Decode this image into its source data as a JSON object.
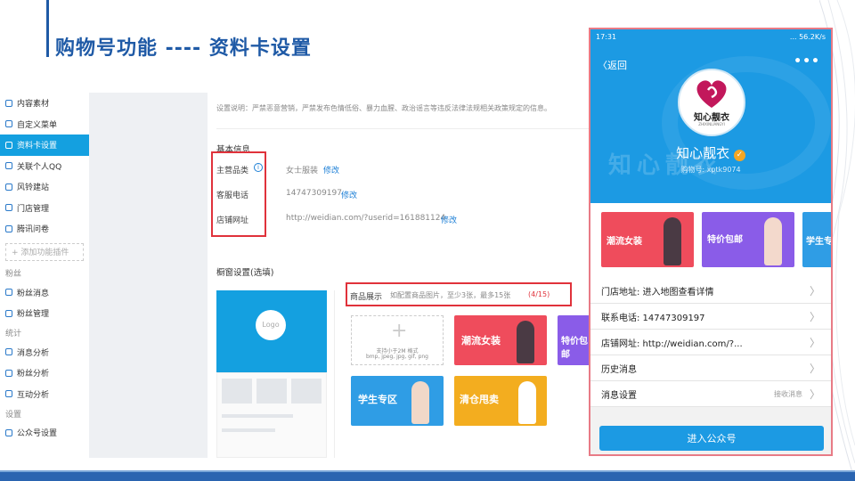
{
  "slide": {
    "title": "购物号功能 ----  资料卡设置"
  },
  "sidebar": {
    "items": [
      {
        "label": "内容素材",
        "icon": "content-icon"
      },
      {
        "label": "自定义菜单",
        "icon": "menu-icon"
      },
      {
        "label": "资料卡设置",
        "icon": "profile-card-icon",
        "active": true
      },
      {
        "label": "关联个人QQ",
        "icon": "link-icon"
      },
      {
        "label": "风铃建站",
        "icon": "site-icon"
      },
      {
        "label": "门店管理",
        "icon": "store-icon"
      },
      {
        "label": "腾讯问卷",
        "icon": "survey-icon"
      }
    ],
    "add_plugin": "+ 添加功能插件",
    "group_fans": "粉丝",
    "fans_items": [
      {
        "label": "粉丝消息",
        "icon": "message-icon"
      },
      {
        "label": "粉丝管理",
        "icon": "fans-icon"
      }
    ],
    "group_stats": "统计",
    "stats_items": [
      {
        "label": "消息分析",
        "icon": "analysis-icon"
      },
      {
        "label": "粉丝分析",
        "icon": "fans-analysis-icon"
      },
      {
        "label": "互动分析",
        "icon": "interaction-icon"
      }
    ],
    "group_settings": "设置",
    "settings_items": [
      {
        "label": "公众号设置",
        "icon": "settings-icon"
      }
    ]
  },
  "main": {
    "notice": "设置说明：严禁恶意营销，严禁发布色情低俗、暴力血腥、政治谣言等违反法律法规相关政策规定的信息。",
    "basic_title": "基本信息",
    "fields": [
      {
        "label": "主营品类",
        "value": "女士服装",
        "action": "修改"
      },
      {
        "label": "客服电话",
        "value": "14747309197",
        "action": "修改"
      },
      {
        "label": "店铺网址",
        "value": "http://weidian.com/?userid=161881124",
        "action": "修改"
      }
    ],
    "window_title": "橱窗设置(选填)",
    "preview_logo": "Logo",
    "showcase_label": "商品展示",
    "showcase_hint": "如配置商品图片，至少3张，最多15张",
    "showcase_count": "(4/15)",
    "upload_hint_1": "支持小于2M 格式",
    "upload_hint_2": "bmp, jpeg, jpg, gif, png",
    "banners": [
      "潮流女装",
      "特价包邮",
      "学生专区",
      "清仓甩卖"
    ]
  },
  "phone": {
    "time": "17:31",
    "net": "... 56.2K/s",
    "battery": "▮▮▮",
    "back": "返回",
    "more": "•••",
    "logo_text": "知心靓衣",
    "logo_sub": "ZHIXINLIANGYI",
    "watermark": "知心靓衣",
    "shop_name": "知心靓衣",
    "shop_id": "购物号: xptk9074",
    "banners": [
      "潮流女装",
      "特价包邮",
      "学生专"
    ],
    "rows": [
      {
        "label": "门店地址: 进入地图查看详情"
      },
      {
        "label": "联系电话: 14747309197"
      },
      {
        "label": "店铺网址: http://weidian.com/?..."
      },
      {
        "label": "历史消息"
      },
      {
        "label": "消息设置",
        "sub": "接收消息"
      }
    ],
    "enter_button": "进入公众号"
  },
  "colors": {
    "accent": "#1c9ae3",
    "title": "#1f5aa6",
    "highlight": "#e0323b"
  }
}
